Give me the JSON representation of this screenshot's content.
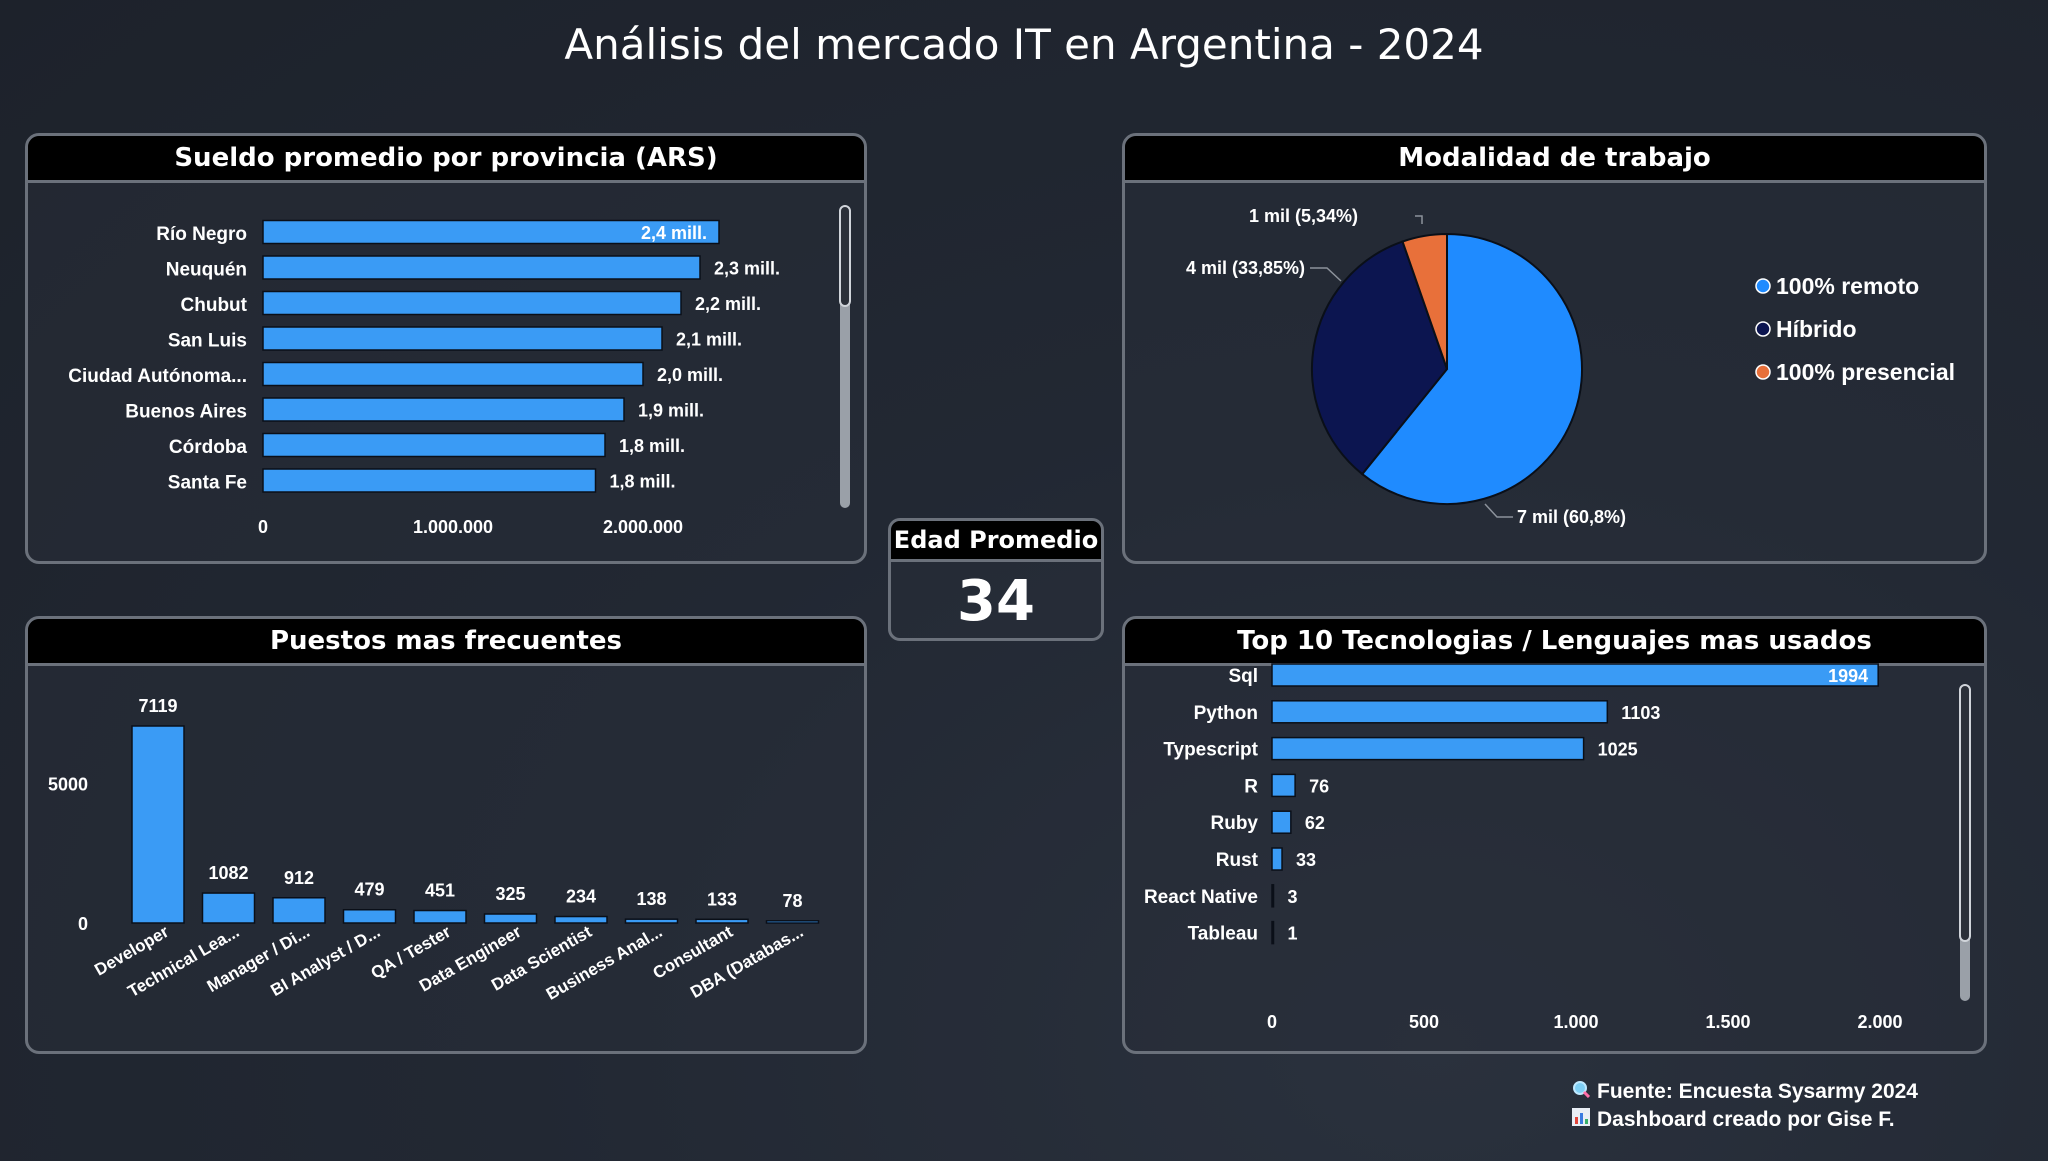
{
  "page": {
    "title": "Análisis del mercado IT en Argentina - 2024",
    "footer_source": "Fuente: Encuesta Sysarmy 2024",
    "footer_credit": "Dashboard creado por Gise F."
  },
  "kpi": {
    "title": "Edad Promedio",
    "value": "34"
  },
  "colors": {
    "bar": "#3a9bf5",
    "remoto": "#1f8bff",
    "hibrido": "#0c1550",
    "presencial": "#e8703a"
  },
  "chart_data": [
    {
      "id": "salary",
      "type": "bar",
      "orientation": "horizontal",
      "title": "Sueldo promedio por provincia (ARS)",
      "categories": [
        "Río Negro",
        "Neuquén",
        "Chubut",
        "San Luis",
        "Ciudad Autónoma...",
        "Buenos Aires",
        "Córdoba",
        "Santa Fe"
      ],
      "values": [
        2400000,
        2300000,
        2200000,
        2100000,
        2000000,
        1900000,
        1800000,
        1750000
      ],
      "data_labels": [
        "2,4 mill.",
        "2,3 mill.",
        "2,2 mill.",
        "2,1 mill.",
        "2,0 mill.",
        "1,9 mill.",
        "1,8 mill.",
        "1,8 mill."
      ],
      "xticks": [
        0,
        1000000,
        2000000
      ],
      "xtick_labels": [
        "0",
        "1.000.000",
        "2.000.000"
      ],
      "xlim": [
        0,
        2500000
      ]
    },
    {
      "id": "modalidad",
      "type": "pie",
      "title": "Modalidad de trabajo",
      "slices": [
        {
          "name": "100% remoto",
          "percent": 60.8,
          "label": "7 mil (60,8%)",
          "color": "#1f8bff"
        },
        {
          "name": "Híbrido",
          "percent": 33.85,
          "label": "4 mil (33,85%)",
          "color": "#0c1550"
        },
        {
          "name": "100% presencial",
          "percent": 5.34,
          "label": "1 mil (5,34%)",
          "color": "#e8703a"
        }
      ],
      "legend_position": "right"
    },
    {
      "id": "puestos",
      "type": "bar",
      "orientation": "vertical",
      "title": "Puestos mas frecuentes",
      "categories": [
        "Developer",
        "Technical Lea...",
        "Manager / Di...",
        "BI Analyst / D...",
        "QA / Tester",
        "Data Engineer",
        "Data Scientist",
        "Business Anal...",
        "Consultant",
        "DBA (Databas..."
      ],
      "values": [
        7119,
        1082,
        912,
        479,
        451,
        325,
        234,
        138,
        133,
        78
      ],
      "yticks": [
        0,
        5000
      ],
      "ylim": [
        0,
        7119
      ]
    },
    {
      "id": "tecnologias",
      "type": "bar",
      "orientation": "horizontal",
      "title": "Top 10 Tecnologias / Lenguajes mas usados",
      "categories": [
        "Sql",
        "Python",
        "Typescript",
        "R",
        "Ruby",
        "Rust",
        "React Native",
        "Tableau"
      ],
      "values": [
        1994,
        1103,
        1025,
        76,
        62,
        33,
        3,
        1
      ],
      "xticks": [
        0,
        500,
        1000,
        1500,
        2000
      ],
      "xtick_labels": [
        "0",
        "500",
        "1.000",
        "1.500",
        "2.000"
      ],
      "xlim": [
        0,
        2000
      ]
    }
  ]
}
